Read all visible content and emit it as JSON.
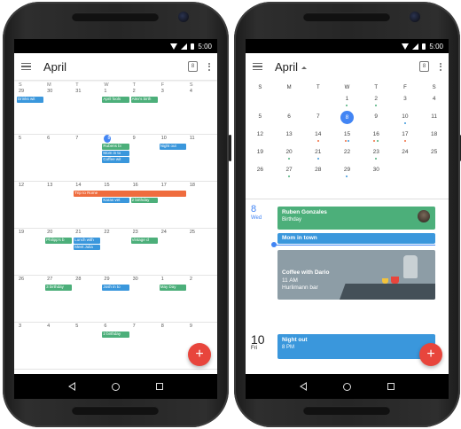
{
  "status": {
    "time": "5:00"
  },
  "left": {
    "title": "April",
    "cal_icon_day": "8",
    "weekdays": [
      "S",
      "M",
      "T",
      "W",
      "T",
      "F",
      "S"
    ],
    "weeks": [
      {
        "days": [
          "29",
          "30",
          "31",
          "1",
          "2",
          "3",
          "4"
        ],
        "events": [
          {
            "label": "Drinks wit",
            "col": 0,
            "row": 0,
            "span": 1,
            "color": "b"
          },
          {
            "label": "April fools",
            "col": 3,
            "row": 0,
            "span": 1,
            "color": "g"
          },
          {
            "label": "Alex's birth",
            "col": 4,
            "row": 0,
            "span": 1,
            "color": "g"
          }
        ]
      },
      {
        "days": [
          "5",
          "6",
          "7",
          "8",
          "9",
          "10",
          "11"
        ],
        "events": [
          {
            "label": "Rubens bi",
            "col": 3,
            "row": 0,
            "span": 1,
            "color": "g"
          },
          {
            "label": "Night out",
            "col": 5,
            "row": 0,
            "span": 1,
            "color": "b"
          },
          {
            "label": "Mom in to",
            "col": 3,
            "row": 1,
            "span": 1,
            "color": "b"
          },
          {
            "label": "Coffee wit",
            "col": 3,
            "row": 2,
            "span": 1,
            "color": "b"
          }
        ]
      },
      {
        "days": [
          "12",
          "13",
          "14",
          "15",
          "16",
          "17",
          "18"
        ],
        "events": [
          {
            "label": "Trip to Rome",
            "col": 2,
            "row": 0,
            "span": 4,
            "color": "o"
          },
          {
            "label": "Karas vet",
            "col": 3,
            "row": 1,
            "span": 1,
            "color": "b"
          },
          {
            "label": "2 birthday",
            "col": 4,
            "row": 1,
            "span": 1,
            "color": "g"
          }
        ]
      },
      {
        "days": [
          "19",
          "20",
          "21",
          "22",
          "23",
          "24",
          "25"
        ],
        "events": [
          {
            "label": "Philipp's b",
            "col": 1,
            "row": 0,
            "span": 1,
            "color": "g"
          },
          {
            "label": "Lunch with",
            "col": 2,
            "row": 0,
            "span": 1,
            "color": "b"
          },
          {
            "label": "Vintage cl",
            "col": 4,
            "row": 0,
            "span": 1,
            "color": "g"
          },
          {
            "label": "Meet Julia",
            "col": 2,
            "row": 1,
            "span": 1,
            "color": "b"
          }
        ]
      },
      {
        "days": [
          "26",
          "27",
          "28",
          "29",
          "30",
          "1",
          "2"
        ],
        "events": [
          {
            "label": "3 birthday",
            "col": 1,
            "row": 0,
            "span": 1,
            "color": "g"
          },
          {
            "label": "Josh in to",
            "col": 3,
            "row": 0,
            "span": 1,
            "color": "b"
          },
          {
            "label": "May Day",
            "col": 5,
            "row": 0,
            "span": 1,
            "color": "g"
          }
        ]
      },
      {
        "days": [
          "3",
          "4",
          "5",
          "6",
          "7",
          "8",
          "9"
        ],
        "events": [
          {
            "label": "2 birthday",
            "col": 3,
            "row": 0,
            "span": 1,
            "color": "g"
          }
        ]
      }
    ],
    "today_index": {
      "week": 1,
      "day": 3
    },
    "fab_label": "+"
  },
  "right": {
    "title": "April",
    "cal_icon_day": "8",
    "weekdays": [
      "S",
      "M",
      "T",
      "W",
      "T",
      "F",
      "S"
    ],
    "rows": [
      [
        {
          "d": ""
        },
        {
          "d": ""
        },
        {
          "d": ""
        },
        {
          "d": "1",
          "dots": [
            "#4caf7a"
          ]
        },
        {
          "d": "2",
          "dots": [
            "#4caf7a"
          ]
        },
        {
          "d": "3"
        },
        {
          "d": "4"
        }
      ],
      [
        {
          "d": "5"
        },
        {
          "d": "6"
        },
        {
          "d": "7"
        },
        {
          "d": "8",
          "sel": true
        },
        {
          "d": "9"
        },
        {
          "d": "10",
          "dots": [
            "#3a97dc"
          ]
        },
        {
          "d": "11"
        }
      ],
      [
        {
          "d": "12"
        },
        {
          "d": "13"
        },
        {
          "d": "14",
          "dots": [
            "#ef6c3e"
          ]
        },
        {
          "d": "15",
          "dots": [
            "#ef6c3e",
            "#3a97dc"
          ]
        },
        {
          "d": "16",
          "dots": [
            "#ef6c3e",
            "#4caf7a"
          ]
        },
        {
          "d": "17",
          "dots": [
            "#ef6c3e"
          ]
        },
        {
          "d": "18"
        }
      ],
      [
        {
          "d": "19"
        },
        {
          "d": "20",
          "dots": [
            "#4caf7a"
          ]
        },
        {
          "d": "21",
          "dots": [
            "#3a97dc"
          ]
        },
        {
          "d": "22"
        },
        {
          "d": "23",
          "dots": [
            "#4caf7a"
          ]
        },
        {
          "d": "24"
        },
        {
          "d": "25"
        }
      ],
      [
        {
          "d": "26"
        },
        {
          "d": "27",
          "dots": [
            "#4caf7a"
          ]
        },
        {
          "d": "28"
        },
        {
          "d": "29",
          "dots": [
            "#3a97dc"
          ]
        },
        {
          "d": "30"
        },
        {
          "d": ""
        },
        {
          "d": ""
        }
      ]
    ],
    "agenda": {
      "day1": {
        "date": "8",
        "dow": "Wed"
      },
      "card1": {
        "title": "Ruben Gonzales",
        "sub": "Birthday"
      },
      "card2": {
        "title": "Mom in town"
      },
      "card3": {
        "title": "Coffee with Dario",
        "time": "11 AM",
        "place": "Hurlimann bar"
      },
      "day2": {
        "date": "10",
        "dow": "Fri"
      },
      "card4": {
        "title": "Night out",
        "sub": "8 PM"
      }
    },
    "fab_label": "+"
  },
  "colors": {
    "green": "#4caf7a",
    "blue": "#3a97dc",
    "orange": "#ef6c3e",
    "accent": "#4285f4",
    "fab": "#e8453c"
  }
}
